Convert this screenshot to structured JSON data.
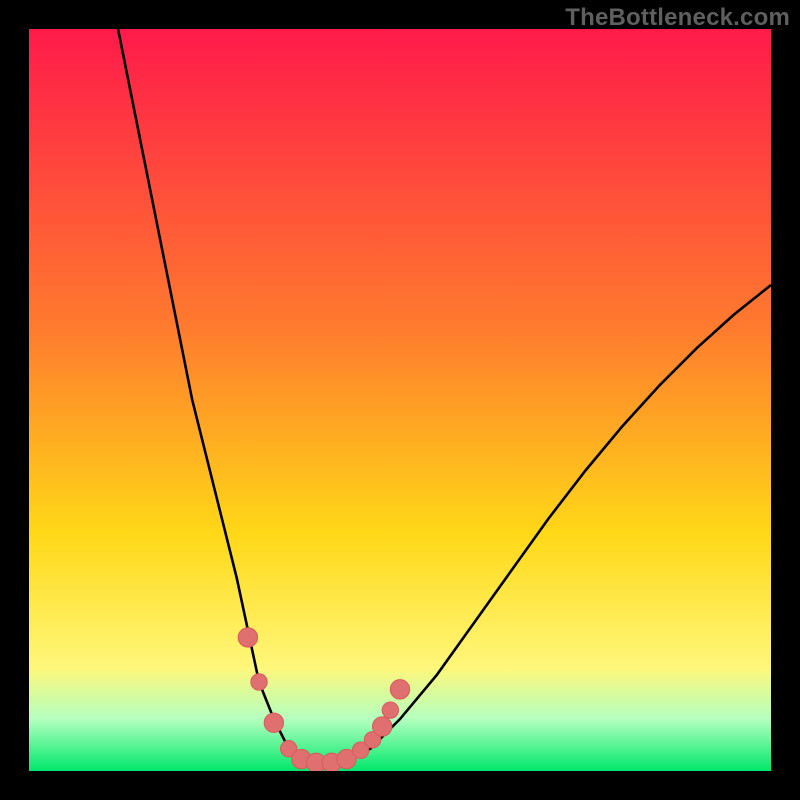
{
  "attribution": "TheBottleneck.com",
  "colors": {
    "frame": "#000000",
    "attribution_text": "#5f5f5f",
    "gradient_top": "#ff1a4a",
    "gradient_upper_mid": "#ff7a2e",
    "gradient_mid": "#ffd817",
    "gradient_low": "#fff77a",
    "gradient_green_top": "#b4ffbf",
    "gradient_green_bot": "#00e86b",
    "curve": "#000000",
    "marker_fill": "#e07070",
    "marker_stroke": "#d85d5d"
  },
  "chart_data": {
    "type": "line",
    "title": "",
    "xlabel": "",
    "ylabel": "",
    "xlim": [
      0,
      100
    ],
    "ylim": [
      0,
      100
    ],
    "grid": false,
    "legend": false,
    "gradient_stops": [
      {
        "offset": 0.0,
        "colorKey": "gradient_top"
      },
      {
        "offset": 0.4,
        "colorKey": "gradient_upper_mid"
      },
      {
        "offset": 0.68,
        "colorKey": "gradient_mid"
      },
      {
        "offset": 0.86,
        "colorKey": "gradient_low"
      },
      {
        "offset": 0.93,
        "colorKey": "gradient_green_top"
      },
      {
        "offset": 1.0,
        "colorKey": "gradient_green_bot"
      }
    ],
    "series": [
      {
        "name": "bottleneck-curve",
        "x": [
          12,
          14,
          16,
          18,
          20,
          22,
          24,
          26,
          28,
          29.5,
          31,
          33,
          35,
          37,
          39,
          42,
          46,
          50,
          55,
          60,
          65,
          70,
          75,
          80,
          85,
          90,
          95,
          100
        ],
        "y": [
          100,
          90,
          80,
          70,
          60,
          50,
          42,
          34,
          26,
          19,
          12,
          7,
          3,
          1.2,
          1,
          1.2,
          3,
          7,
          13,
          20,
          27,
          34,
          40.5,
          46.5,
          52,
          57,
          61.5,
          65.5
        ]
      }
    ],
    "markers": [
      {
        "x": 29.5,
        "y": 18,
        "r": 1.3
      },
      {
        "x": 31.0,
        "y": 12,
        "r": 1.1
      },
      {
        "x": 33.0,
        "y": 6.5,
        "r": 1.3
      },
      {
        "x": 35.0,
        "y": 3.0,
        "r": 1.1
      },
      {
        "x": 36.7,
        "y": 1.6,
        "r": 1.3
      },
      {
        "x": 38.7,
        "y": 1.1,
        "r": 1.3
      },
      {
        "x": 40.8,
        "y": 1.1,
        "r": 1.3
      },
      {
        "x": 42.8,
        "y": 1.6,
        "r": 1.3
      },
      {
        "x": 44.7,
        "y": 2.8,
        "r": 1.1
      },
      {
        "x": 46.3,
        "y": 4.2,
        "r": 1.1
      },
      {
        "x": 47.6,
        "y": 6.0,
        "r": 1.3
      },
      {
        "x": 48.7,
        "y": 8.2,
        "r": 1.1
      },
      {
        "x": 50.0,
        "y": 11,
        "r": 1.3
      }
    ]
  }
}
